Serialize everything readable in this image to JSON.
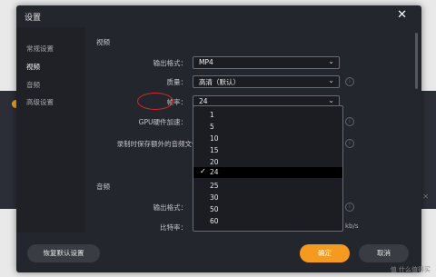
{
  "dialog": {
    "title": "设置",
    "close_icon": "close-icon"
  },
  "sidebar": {
    "items": [
      {
        "label": "常规设置",
        "active": false
      },
      {
        "label": "视频",
        "active": true
      },
      {
        "label": "音频",
        "active": false
      },
      {
        "label": "高级设置",
        "active": false
      }
    ]
  },
  "video": {
    "section_title": "视频",
    "output_format": {
      "label": "输出格式：",
      "value": "MP4"
    },
    "quality": {
      "label": "质量：",
      "value": "高清（默认）"
    },
    "frame_rate": {
      "label": "帧率：",
      "value": "24"
    },
    "gpu": {
      "label": "GPU硬件加速："
    },
    "record_audio": {
      "label": "录制时保存额外的音频文件："
    }
  },
  "audio": {
    "section_title": "音频",
    "output_format": {
      "label": "输出格式："
    },
    "bitrate": {
      "label": "比特率：",
      "unit": "kb/s"
    }
  },
  "dropdown": {
    "options": [
      "1",
      "5",
      "10",
      "15",
      "20",
      "24",
      "25",
      "30",
      "50",
      "60"
    ],
    "selected": "24"
  },
  "footer": {
    "reset_label": "恢复默认设置",
    "ok_label": "确定",
    "cancel_label": "取消"
  },
  "watermark": "值 什么值得买",
  "colors": {
    "accent": "#f39a1f",
    "dialog_bg": "#24262d",
    "highlight": "#d8282b"
  }
}
